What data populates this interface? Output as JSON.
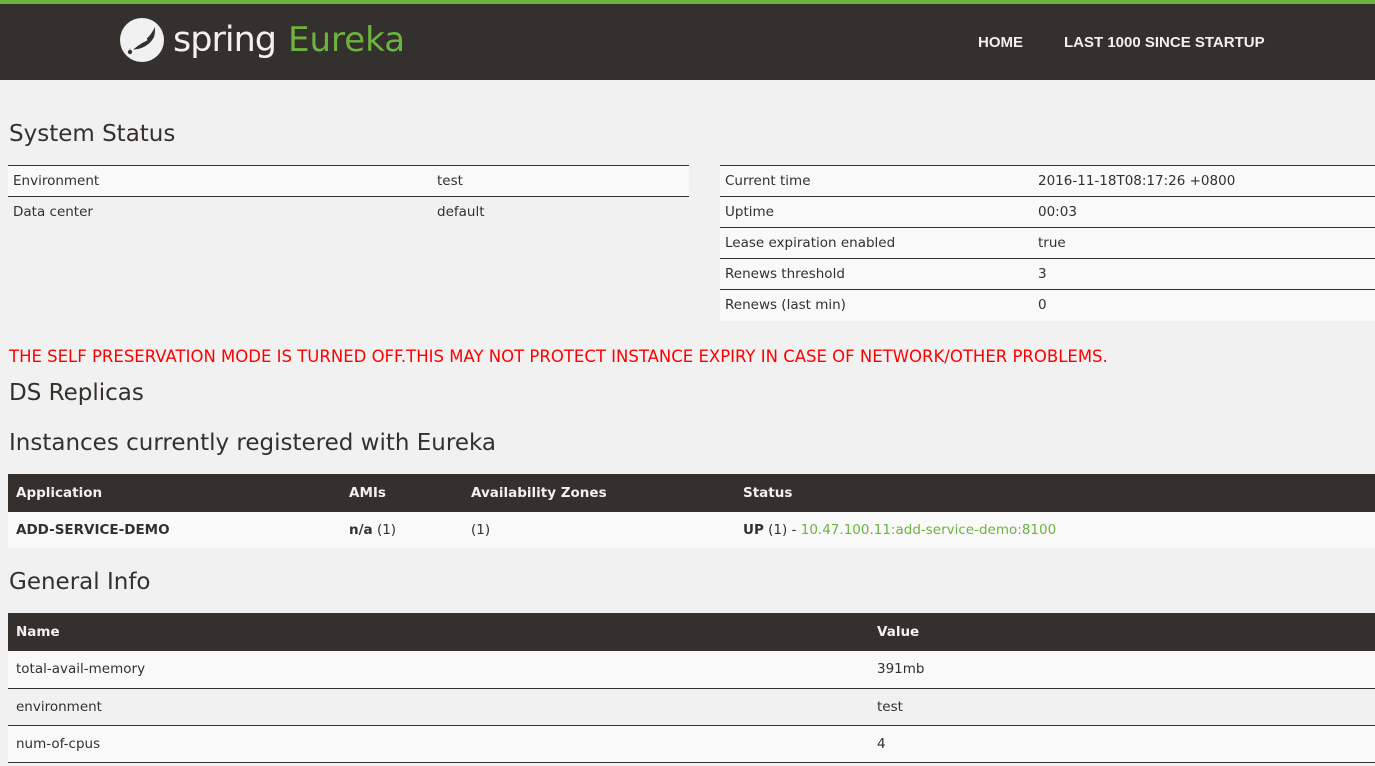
{
  "header": {
    "brand_spring": "spring",
    "brand_eureka": "Eureka",
    "nav": [
      "HOME",
      "LAST 1000 SINCE STARTUP"
    ],
    "accent": "#6db33f",
    "bar_color": "#34302d"
  },
  "system_status": {
    "title": "System Status",
    "left": [
      {
        "label": "Environment",
        "value": "test"
      },
      {
        "label": "Data center",
        "value": "default"
      }
    ],
    "right": [
      {
        "label": "Current time",
        "value": "2016-11-18T08:17:26 +0800"
      },
      {
        "label": "Uptime",
        "value": "00:03"
      },
      {
        "label": "Lease expiration enabled",
        "value": "true"
      },
      {
        "label": "Renews threshold",
        "value": "3"
      },
      {
        "label": "Renews (last min)",
        "value": "0"
      }
    ]
  },
  "warning": "THE SELF PRESERVATION MODE IS TURNED OFF.THIS MAY NOT PROTECT INSTANCE EXPIRY IN CASE OF NETWORK/OTHER PROBLEMS.",
  "ds_replicas": {
    "title": "DS Replicas"
  },
  "instances": {
    "title": "Instances currently registered with Eureka",
    "columns": [
      "Application",
      "AMIs",
      "Availability Zones",
      "Status"
    ],
    "rows": [
      {
        "application": "ADD-SERVICE-DEMO",
        "amis_bold": "n/a",
        "amis_count": "(1)",
        "zones": "(1)",
        "status_bold": "UP",
        "status_count": "(1) -",
        "instance_link": "10.47.100.11:add-service-demo:8100"
      }
    ]
  },
  "general_info": {
    "title": "General Info",
    "columns": [
      "Name",
      "Value"
    ],
    "rows": [
      {
        "name": "total-avail-memory",
        "value": "391mb"
      },
      {
        "name": "environment",
        "value": "test"
      },
      {
        "name": "num-of-cpus",
        "value": "4"
      }
    ]
  }
}
